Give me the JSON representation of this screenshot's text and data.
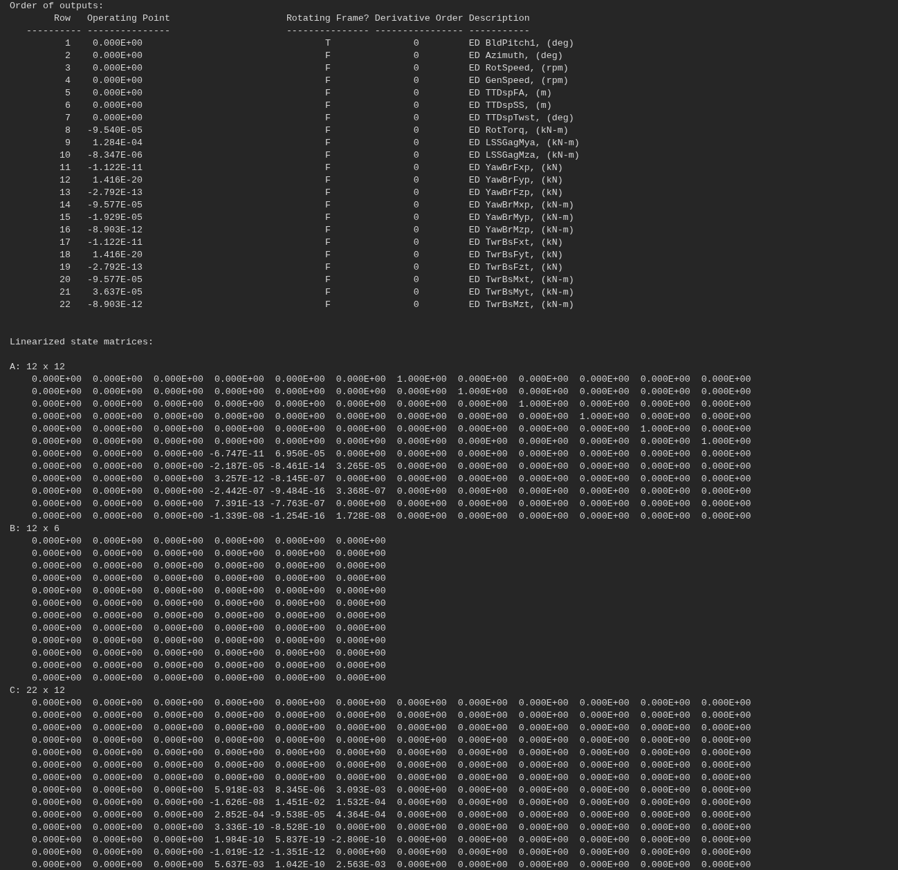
{
  "outputs": {
    "title": "Order of outputs:",
    "columns": [
      "Row",
      "Operating Point",
      "Rotating Frame?",
      "Derivative Order",
      "Description"
    ],
    "rules": [
      "----------",
      "---------------",
      "---------------",
      "----------------",
      "-----------"
    ],
    "rows": [
      {
        "row": "1",
        "operating_point": "0.000E+00",
        "rotating_frame": "T",
        "derivative_order": "0",
        "description": "ED BldPitch1, (deg)"
      },
      {
        "row": "2",
        "operating_point": "0.000E+00",
        "rotating_frame": "F",
        "derivative_order": "0",
        "description": "ED Azimuth, (deg)"
      },
      {
        "row": "3",
        "operating_point": "0.000E+00",
        "rotating_frame": "F",
        "derivative_order": "0",
        "description": "ED RotSpeed, (rpm)"
      },
      {
        "row": "4",
        "operating_point": "0.000E+00",
        "rotating_frame": "F",
        "derivative_order": "0",
        "description": "ED GenSpeed, (rpm)"
      },
      {
        "row": "5",
        "operating_point": "0.000E+00",
        "rotating_frame": "F",
        "derivative_order": "0",
        "description": "ED TTDspFA, (m)"
      },
      {
        "row": "6",
        "operating_point": "0.000E+00",
        "rotating_frame": "F",
        "derivative_order": "0",
        "description": "ED TTDspSS, (m)"
      },
      {
        "row": "7",
        "operating_point": "0.000E+00",
        "rotating_frame": "F",
        "derivative_order": "0",
        "description": "ED TTDspTwst, (deg)"
      },
      {
        "row": "8",
        "operating_point": "-9.540E-05",
        "rotating_frame": "F",
        "derivative_order": "0",
        "description": "ED RotTorq, (kN-m)"
      },
      {
        "row": "9",
        "operating_point": "1.284E-04",
        "rotating_frame": "F",
        "derivative_order": "0",
        "description": "ED LSSGagMya, (kN-m)"
      },
      {
        "row": "10",
        "operating_point": "-8.347E-06",
        "rotating_frame": "F",
        "derivative_order": "0",
        "description": "ED LSSGagMza, (kN-m)"
      },
      {
        "row": "11",
        "operating_point": "-1.122E-11",
        "rotating_frame": "F",
        "derivative_order": "0",
        "description": "ED YawBrFxp, (kN)"
      },
      {
        "row": "12",
        "operating_point": "1.416E-20",
        "rotating_frame": "F",
        "derivative_order": "0",
        "description": "ED YawBrFyp, (kN)"
      },
      {
        "row": "13",
        "operating_point": "-2.792E-13",
        "rotating_frame": "F",
        "derivative_order": "0",
        "description": "ED YawBrFzp, (kN)"
      },
      {
        "row": "14",
        "operating_point": "-9.577E-05",
        "rotating_frame": "F",
        "derivative_order": "0",
        "description": "ED YawBrMxp, (kN-m)"
      },
      {
        "row": "15",
        "operating_point": "-1.929E-05",
        "rotating_frame": "F",
        "derivative_order": "0",
        "description": "ED YawBrMyp, (kN-m)"
      },
      {
        "row": "16",
        "operating_point": "-8.903E-12",
        "rotating_frame": "F",
        "derivative_order": "0",
        "description": "ED YawBrMzp, (kN-m)"
      },
      {
        "row": "17",
        "operating_point": "-1.122E-11",
        "rotating_frame": "F",
        "derivative_order": "0",
        "description": "ED TwrBsFxt, (kN)"
      },
      {
        "row": "18",
        "operating_point": "1.416E-20",
        "rotating_frame": "F",
        "derivative_order": "0",
        "description": "ED TwrBsFyt, (kN)"
      },
      {
        "row": "19",
        "operating_point": "-2.792E-13",
        "rotating_frame": "F",
        "derivative_order": "0",
        "description": "ED TwrBsFzt, (kN)"
      },
      {
        "row": "20",
        "operating_point": "-9.577E-05",
        "rotating_frame": "F",
        "derivative_order": "0",
        "description": "ED TwrBsMxt, (kN-m)"
      },
      {
        "row": "21",
        "operating_point": "3.637E-05",
        "rotating_frame": "F",
        "derivative_order": "0",
        "description": "ED TwrBsMyt, (kN-m)"
      },
      {
        "row": "22",
        "operating_point": "-8.903E-12",
        "rotating_frame": "F",
        "derivative_order": "0",
        "description": "ED TwrBsMzt, (kN-m)"
      }
    ]
  },
  "matrices_title": "Linearized state matrices:",
  "matrices": [
    {
      "label": "A: 12 x 12",
      "rows": [
        [
          "0.000E+00",
          "0.000E+00",
          "0.000E+00",
          "0.000E+00",
          "0.000E+00",
          "0.000E+00",
          "1.000E+00",
          "0.000E+00",
          "0.000E+00",
          "0.000E+00",
          "0.000E+00",
          "0.000E+00"
        ],
        [
          "0.000E+00",
          "0.000E+00",
          "0.000E+00",
          "0.000E+00",
          "0.000E+00",
          "0.000E+00",
          "0.000E+00",
          "1.000E+00",
          "0.000E+00",
          "0.000E+00",
          "0.000E+00",
          "0.000E+00"
        ],
        [
          "0.000E+00",
          "0.000E+00",
          "0.000E+00",
          "0.000E+00",
          "0.000E+00",
          "0.000E+00",
          "0.000E+00",
          "0.000E+00",
          "1.000E+00",
          "0.000E+00",
          "0.000E+00",
          "0.000E+00"
        ],
        [
          "0.000E+00",
          "0.000E+00",
          "0.000E+00",
          "0.000E+00",
          "0.000E+00",
          "0.000E+00",
          "0.000E+00",
          "0.000E+00",
          "0.000E+00",
          "1.000E+00",
          "0.000E+00",
          "0.000E+00"
        ],
        [
          "0.000E+00",
          "0.000E+00",
          "0.000E+00",
          "0.000E+00",
          "0.000E+00",
          "0.000E+00",
          "0.000E+00",
          "0.000E+00",
          "0.000E+00",
          "0.000E+00",
          "1.000E+00",
          "0.000E+00"
        ],
        [
          "0.000E+00",
          "0.000E+00",
          "0.000E+00",
          "0.000E+00",
          "0.000E+00",
          "0.000E+00",
          "0.000E+00",
          "0.000E+00",
          "0.000E+00",
          "0.000E+00",
          "0.000E+00",
          "1.000E+00"
        ],
        [
          "0.000E+00",
          "0.000E+00",
          "0.000E+00",
          "-6.747E-11",
          "6.950E-05",
          "0.000E+00",
          "0.000E+00",
          "0.000E+00",
          "0.000E+00",
          "0.000E+00",
          "0.000E+00",
          "0.000E+00"
        ],
        [
          "0.000E+00",
          "0.000E+00",
          "0.000E+00",
          "-2.187E-05",
          "-8.461E-14",
          "3.265E-05",
          "0.000E+00",
          "0.000E+00",
          "0.000E+00",
          "0.000E+00",
          "0.000E+00",
          "0.000E+00"
        ],
        [
          "0.000E+00",
          "0.000E+00",
          "0.000E+00",
          "3.257E-12",
          "-8.145E-07",
          "0.000E+00",
          "0.000E+00",
          "0.000E+00",
          "0.000E+00",
          "0.000E+00",
          "0.000E+00",
          "0.000E+00"
        ],
        [
          "0.000E+00",
          "0.000E+00",
          "0.000E+00",
          "-2.442E-07",
          "-9.484E-16",
          "3.368E-07",
          "0.000E+00",
          "0.000E+00",
          "0.000E+00",
          "0.000E+00",
          "0.000E+00",
          "0.000E+00"
        ],
        [
          "0.000E+00",
          "0.000E+00",
          "0.000E+00",
          "7.391E-13",
          "-7.763E-07",
          "0.000E+00",
          "0.000E+00",
          "0.000E+00",
          "0.000E+00",
          "0.000E+00",
          "0.000E+00",
          "0.000E+00"
        ],
        [
          "0.000E+00",
          "0.000E+00",
          "0.000E+00",
          "-1.339E-08",
          "-1.254E-16",
          "1.728E-08",
          "0.000E+00",
          "0.000E+00",
          "0.000E+00",
          "0.000E+00",
          "0.000E+00",
          "0.000E+00"
        ]
      ]
    },
    {
      "label": "B: 12 x 6",
      "rows": [
        [
          "0.000E+00",
          "0.000E+00",
          "0.000E+00",
          "0.000E+00",
          "0.000E+00",
          "0.000E+00"
        ],
        [
          "0.000E+00",
          "0.000E+00",
          "0.000E+00",
          "0.000E+00",
          "0.000E+00",
          "0.000E+00"
        ],
        [
          "0.000E+00",
          "0.000E+00",
          "0.000E+00",
          "0.000E+00",
          "0.000E+00",
          "0.000E+00"
        ],
        [
          "0.000E+00",
          "0.000E+00",
          "0.000E+00",
          "0.000E+00",
          "0.000E+00",
          "0.000E+00"
        ],
        [
          "0.000E+00",
          "0.000E+00",
          "0.000E+00",
          "0.000E+00",
          "0.000E+00",
          "0.000E+00"
        ],
        [
          "0.000E+00",
          "0.000E+00",
          "0.000E+00",
          "0.000E+00",
          "0.000E+00",
          "0.000E+00"
        ],
        [
          "0.000E+00",
          "0.000E+00",
          "0.000E+00",
          "0.000E+00",
          "0.000E+00",
          "0.000E+00"
        ],
        [
          "0.000E+00",
          "0.000E+00",
          "0.000E+00",
          "0.000E+00",
          "0.000E+00",
          "0.000E+00"
        ],
        [
          "0.000E+00",
          "0.000E+00",
          "0.000E+00",
          "0.000E+00",
          "0.000E+00",
          "0.000E+00"
        ],
        [
          "0.000E+00",
          "0.000E+00",
          "0.000E+00",
          "0.000E+00",
          "0.000E+00",
          "0.000E+00"
        ],
        [
          "0.000E+00",
          "0.000E+00",
          "0.000E+00",
          "0.000E+00",
          "0.000E+00",
          "0.000E+00"
        ],
        [
          "0.000E+00",
          "0.000E+00",
          "0.000E+00",
          "0.000E+00",
          "0.000E+00",
          "0.000E+00"
        ]
      ]
    },
    {
      "label": "C: 22 x 12",
      "rows": [
        [
          "0.000E+00",
          "0.000E+00",
          "0.000E+00",
          "0.000E+00",
          "0.000E+00",
          "0.000E+00",
          "0.000E+00",
          "0.000E+00",
          "0.000E+00",
          "0.000E+00",
          "0.000E+00",
          "0.000E+00"
        ],
        [
          "0.000E+00",
          "0.000E+00",
          "0.000E+00",
          "0.000E+00",
          "0.000E+00",
          "0.000E+00",
          "0.000E+00",
          "0.000E+00",
          "0.000E+00",
          "0.000E+00",
          "0.000E+00",
          "0.000E+00"
        ],
        [
          "0.000E+00",
          "0.000E+00",
          "0.000E+00",
          "0.000E+00",
          "0.000E+00",
          "0.000E+00",
          "0.000E+00",
          "0.000E+00",
          "0.000E+00",
          "0.000E+00",
          "0.000E+00",
          "0.000E+00"
        ],
        [
          "0.000E+00",
          "0.000E+00",
          "0.000E+00",
          "0.000E+00",
          "0.000E+00",
          "0.000E+00",
          "0.000E+00",
          "0.000E+00",
          "0.000E+00",
          "0.000E+00",
          "0.000E+00",
          "0.000E+00"
        ],
        [
          "0.000E+00",
          "0.000E+00",
          "0.000E+00",
          "0.000E+00",
          "0.000E+00",
          "0.000E+00",
          "0.000E+00",
          "0.000E+00",
          "0.000E+00",
          "0.000E+00",
          "0.000E+00",
          "0.000E+00"
        ],
        [
          "0.000E+00",
          "0.000E+00",
          "0.000E+00",
          "0.000E+00",
          "0.000E+00",
          "0.000E+00",
          "0.000E+00",
          "0.000E+00",
          "0.000E+00",
          "0.000E+00",
          "0.000E+00",
          "0.000E+00"
        ],
        [
          "0.000E+00",
          "0.000E+00",
          "0.000E+00",
          "0.000E+00",
          "0.000E+00",
          "0.000E+00",
          "0.000E+00",
          "0.000E+00",
          "0.000E+00",
          "0.000E+00",
          "0.000E+00",
          "0.000E+00"
        ],
        [
          "0.000E+00",
          "0.000E+00",
          "0.000E+00",
          "5.918E-03",
          "8.345E-06",
          "3.093E-03",
          "0.000E+00",
          "0.000E+00",
          "0.000E+00",
          "0.000E+00",
          "0.000E+00",
          "0.000E+00"
        ],
        [
          "0.000E+00",
          "0.000E+00",
          "0.000E+00",
          "-1.626E-08",
          "1.451E-02",
          "1.532E-04",
          "0.000E+00",
          "0.000E+00",
          "0.000E+00",
          "0.000E+00",
          "0.000E+00",
          "0.000E+00"
        ],
        [
          "0.000E+00",
          "0.000E+00",
          "0.000E+00",
          "2.852E-04",
          "-9.538E-05",
          "4.364E-04",
          "0.000E+00",
          "0.000E+00",
          "0.000E+00",
          "0.000E+00",
          "0.000E+00",
          "0.000E+00"
        ],
        [
          "0.000E+00",
          "0.000E+00",
          "0.000E+00",
          "3.336E-10",
          "-8.528E-10",
          "0.000E+00",
          "0.000E+00",
          "0.000E+00",
          "0.000E+00",
          "0.000E+00",
          "0.000E+00",
          "0.000E+00"
        ],
        [
          "0.000E+00",
          "0.000E+00",
          "0.000E+00",
          "1.984E-10",
          "5.837E-19",
          "-2.800E-10",
          "0.000E+00",
          "0.000E+00",
          "0.000E+00",
          "0.000E+00",
          "0.000E+00",
          "0.000E+00"
        ],
        [
          "0.000E+00",
          "0.000E+00",
          "0.000E+00",
          "-1.019E-12",
          "-1.351E-12",
          "0.000E+00",
          "0.000E+00",
          "0.000E+00",
          "0.000E+00",
          "0.000E+00",
          "0.000E+00",
          "0.000E+00"
        ],
        [
          "0.000E+00",
          "0.000E+00",
          "0.000E+00",
          "5.637E-03",
          "1.042E-10",
          "2.563E-03",
          "0.000E+00",
          "0.000E+00",
          "0.000E+00",
          "0.000E+00",
          "0.000E+00",
          "0.000E+00"
        ]
      ]
    }
  ]
}
